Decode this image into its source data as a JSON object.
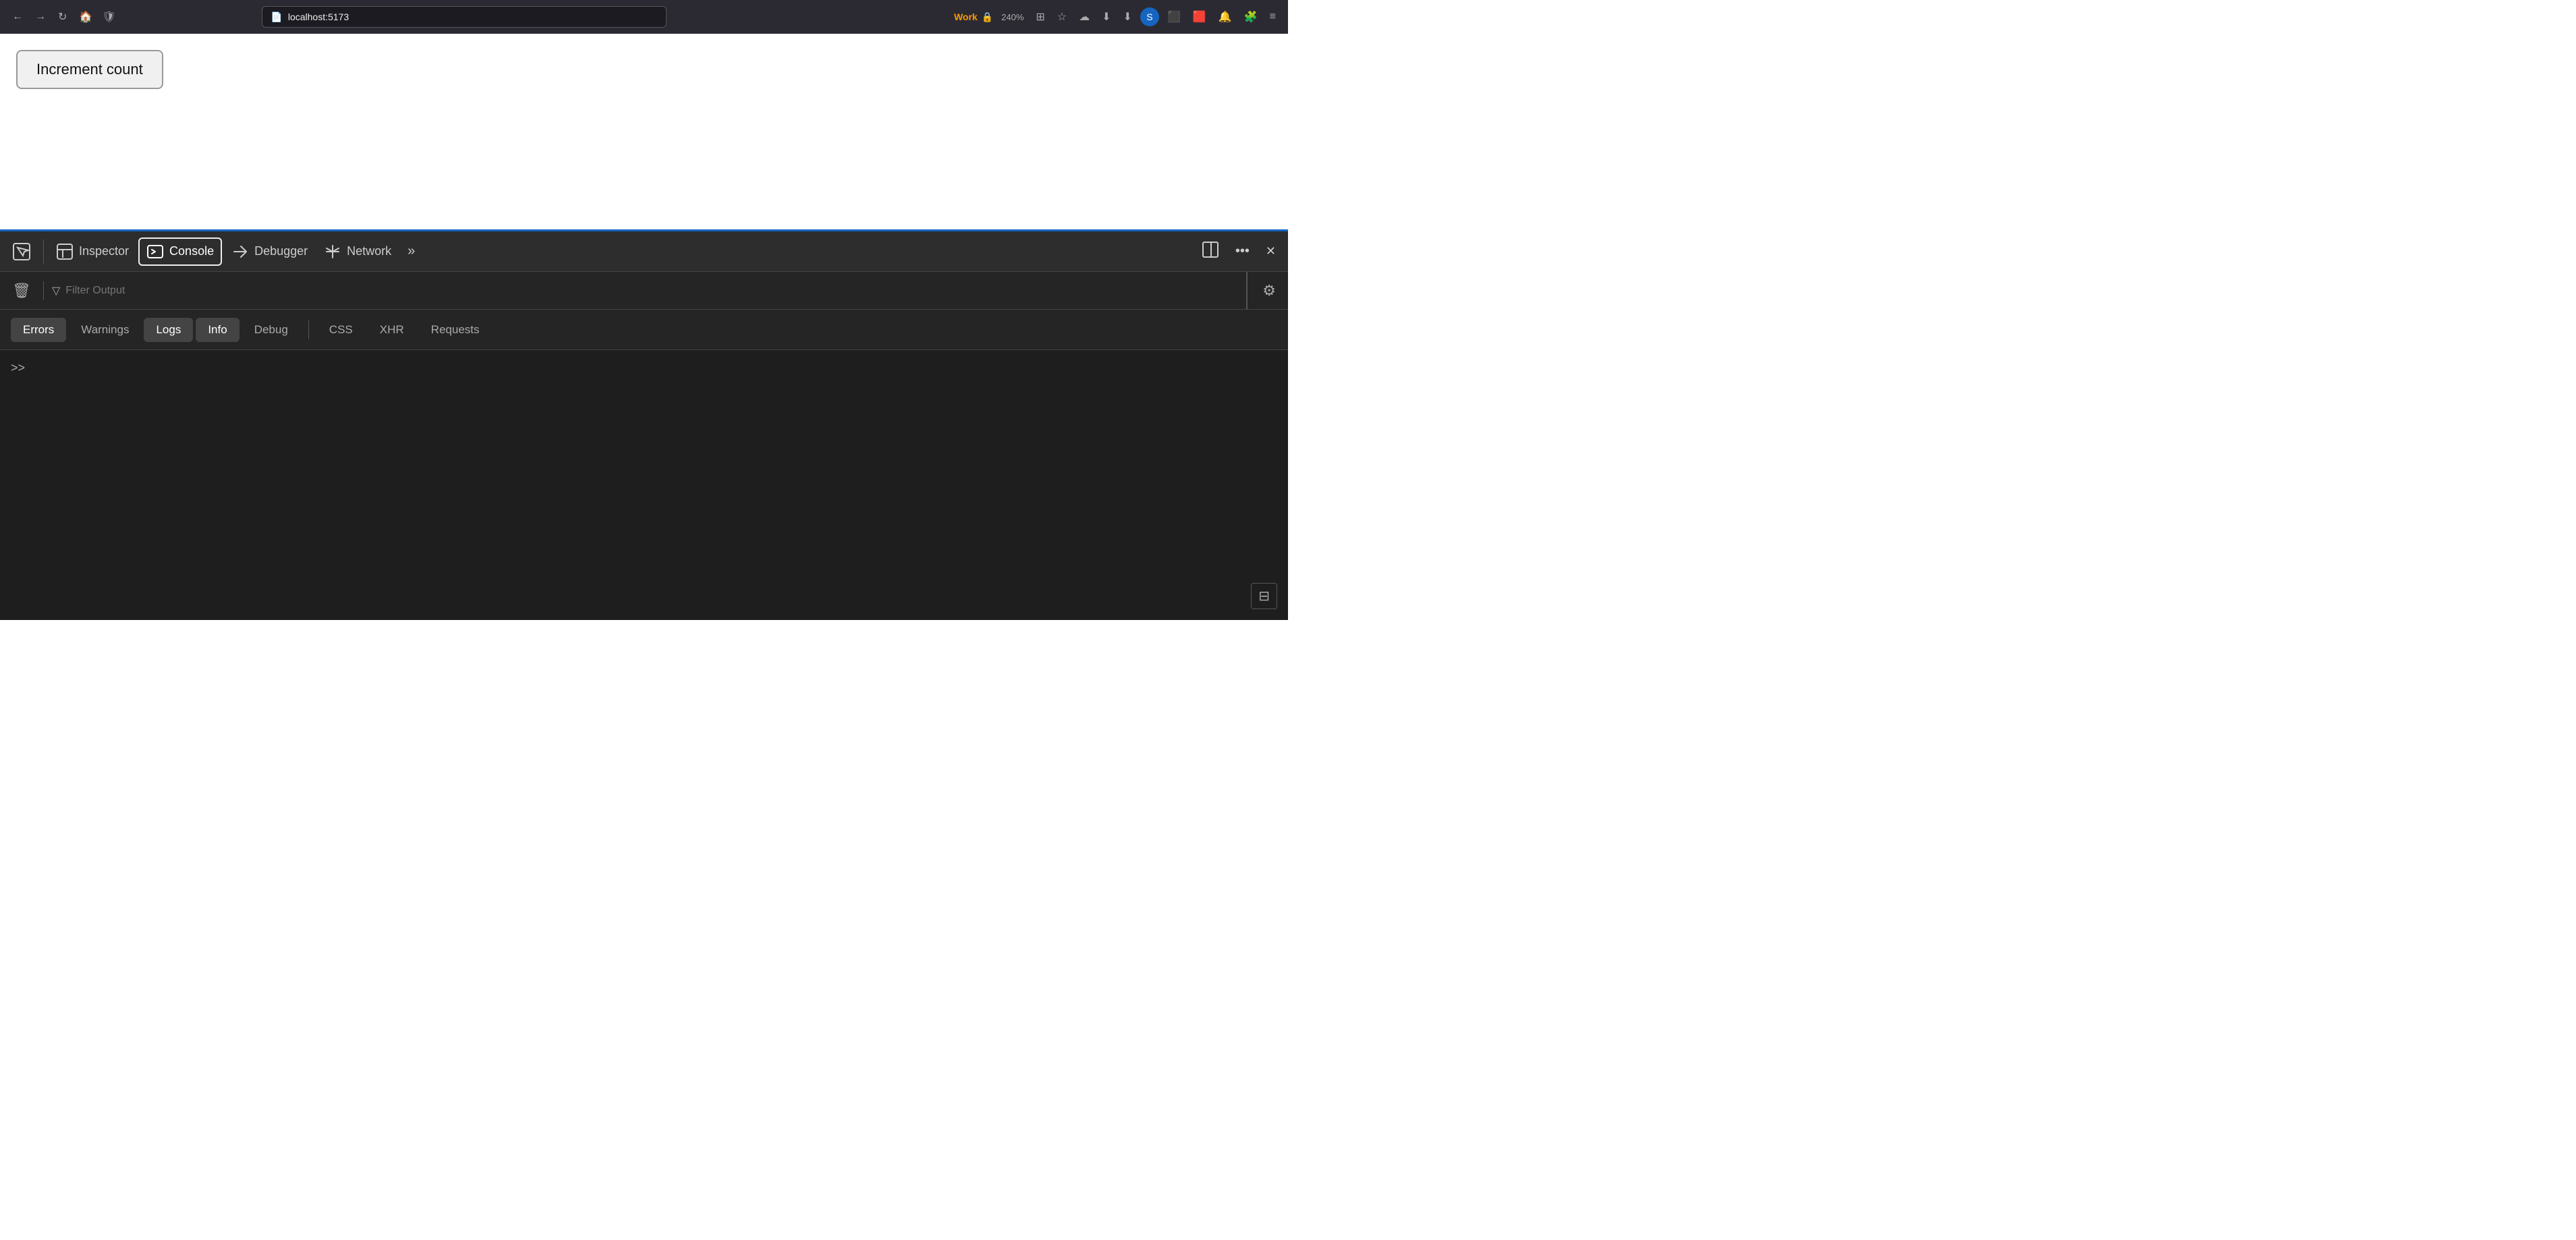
{
  "browser": {
    "back_label": "←",
    "forward_label": "→",
    "reload_label": "↻",
    "home_label": "🏠",
    "url": "localhost:5173",
    "work_label": "Work",
    "zoom_label": "240%",
    "bookmark_label": "☆",
    "downloads_label": "⬇",
    "sync_label": "⬇",
    "profile_label": "S",
    "extensions_label": "⊞",
    "app_label": "🔴",
    "bell_label": "🔔",
    "puzzle_label": "🧩",
    "menu_label": "≡"
  },
  "page": {
    "increment_button_label": "Increment count"
  },
  "devtools": {
    "selector_icon": "⬚",
    "inspector_label": "Inspector",
    "console_label": "Console",
    "debugger_label": "Debugger",
    "network_label": "Network",
    "more_label": "»",
    "layout_icon": "⬜",
    "ellipsis_label": "•••",
    "close_label": "✕",
    "trash_label": "🗑",
    "filter_label": "Filter Output",
    "settings_label": "⚙",
    "tabs": [
      {
        "id": "errors",
        "label": "Errors",
        "active": true
      },
      {
        "id": "warnings",
        "label": "Warnings",
        "active": false
      },
      {
        "id": "logs",
        "label": "Logs",
        "active": true
      },
      {
        "id": "info",
        "label": "Info",
        "active": true
      },
      {
        "id": "debug",
        "label": "Debug",
        "active": false
      }
    ],
    "tabs2": [
      {
        "id": "css",
        "label": "CSS",
        "active": false
      },
      {
        "id": "xhr",
        "label": "XHR",
        "active": false
      },
      {
        "id": "requests",
        "label": "Requests",
        "active": false
      }
    ],
    "prompt_label": ">>",
    "side_panel_icon": "⊟"
  }
}
